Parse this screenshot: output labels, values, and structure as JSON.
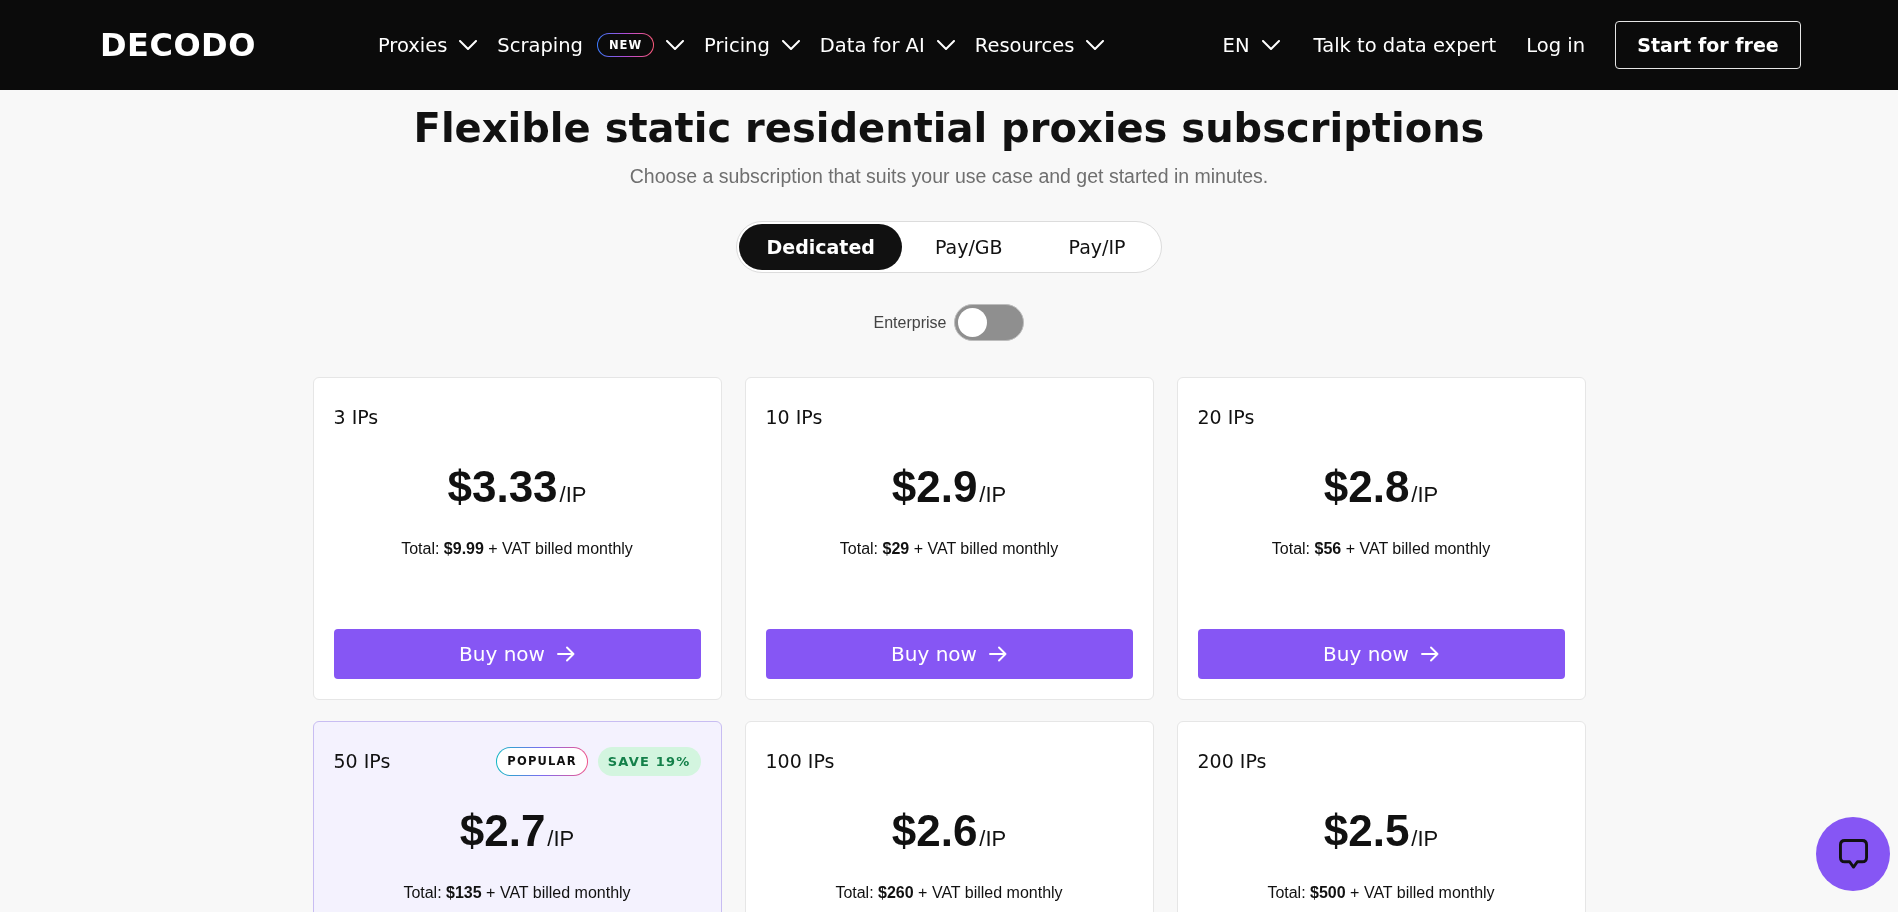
{
  "nav": {
    "logo": "DECODO",
    "items": [
      {
        "label": "Proxies",
        "dropdown": true
      },
      {
        "label": "Scraping",
        "badge": "NEW",
        "dropdown": true
      },
      {
        "label": "Pricing",
        "dropdown": true
      },
      {
        "label": "Data for AI",
        "dropdown": true
      },
      {
        "label": "Resources",
        "dropdown": true
      }
    ],
    "language": {
      "label": "EN",
      "dropdown": true
    },
    "links": [
      "Talk to data expert",
      "Log in"
    ],
    "cta": "Start for free"
  },
  "hero": {
    "title": "Flexible static residential proxies subscriptions",
    "subtitle": "Choose a subscription that suits your use case and get started in minutes."
  },
  "plan_tabs": [
    {
      "label": "Dedicated",
      "selected": true
    },
    {
      "label": "Pay/GB",
      "selected": false
    },
    {
      "label": "Pay/IP",
      "selected": false
    }
  ],
  "enterprise_toggle": {
    "label": "Enterprise",
    "on": false
  },
  "plans": [
    {
      "name": "3 IPs",
      "price": "$3.33",
      "unit": "/IP",
      "total": "Total: **$9.99** + VAT billed monthly",
      "button": "Buy now",
      "highlighted": false
    },
    {
      "name": "10 IPs",
      "price": "$2.9",
      "unit": "/IP",
      "total": "Total: **$29** + VAT billed monthly",
      "button": "Buy now",
      "highlighted": false
    },
    {
      "name": "20 IPs",
      "price": "$2.8",
      "unit": "/IP",
      "total": "Total: **$56** + VAT billed monthly",
      "button": "Buy now",
      "highlighted": false
    },
    {
      "name": "50 IPs",
      "badges": [
        {
          "label": "POPULAR",
          "kind": "popular"
        },
        {
          "label": "SAVE 19%",
          "kind": "save"
        }
      ],
      "price": "$2.7",
      "unit": "/IP",
      "total": "Total: **$135** + VAT billed monthly",
      "highlighted": true
    },
    {
      "name": "100 IPs",
      "price": "$2.6",
      "unit": "/IP",
      "total": "Total: **$260** + VAT billed monthly",
      "highlighted": false
    },
    {
      "name": "200 IPs",
      "price": "$2.5",
      "unit": "/IP",
      "total": "Total: **$500** + VAT billed monthly",
      "highlighted": false
    }
  ]
}
